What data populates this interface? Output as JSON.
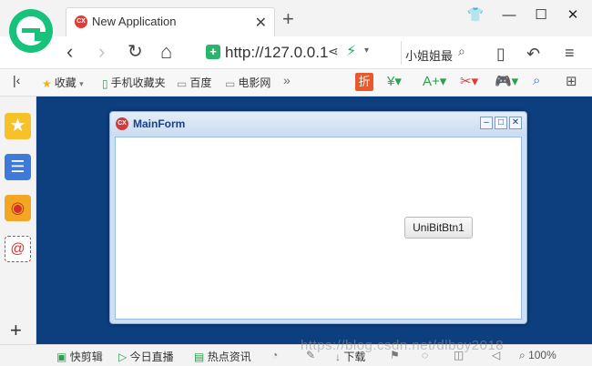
{
  "browser": {
    "tab_title": "New Application",
    "tab_icon_text": "CX",
    "new_tab": "+",
    "close_tab": "✕",
    "window_buttons": [
      "👕",
      "—",
      "☐",
      "✕"
    ],
    "url": "http://127.0.0.1",
    "search_query": "小姐姐最",
    "bookmarks": [
      {
        "label": "收藏",
        "icon": "star-icon"
      },
      {
        "label": "手机收藏夹",
        "icon": "phone-icon"
      },
      {
        "label": "百度",
        "icon": "page-icon"
      },
      {
        "label": "电影网",
        "icon": "page-icon"
      }
    ],
    "bookmark_more": "»",
    "discount_badge": "折"
  },
  "form": {
    "title": "MainForm",
    "icon_text": "CX",
    "button_label": "UniBitBtn1"
  },
  "sidebar": {
    "add": "+"
  },
  "status": {
    "items": [
      "快剪辑",
      "今日直播",
      "热点资讯",
      "下载"
    ],
    "zoom": "100%"
  },
  "watermark": "https://blog.csdn.net/dlboy2018",
  "colors": {
    "content_bg": "#0d3e7d",
    "brand": "#17c37b",
    "form_title": "#15428b"
  }
}
